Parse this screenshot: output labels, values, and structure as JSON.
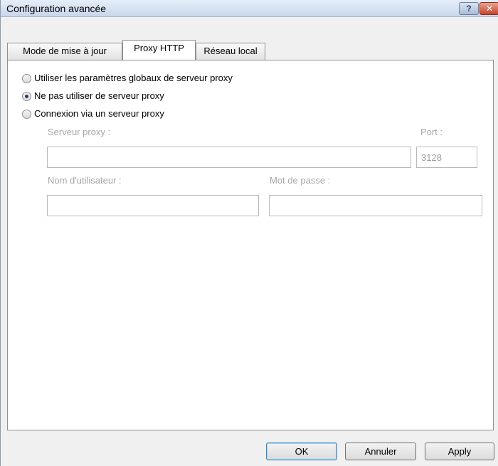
{
  "window": {
    "title": "Configuration avancée",
    "help_label": "?",
    "close_label": "✕"
  },
  "tabs": [
    {
      "label": "Mode de mise à jour",
      "active": false
    },
    {
      "label": "Proxy HTTP",
      "active": true
    },
    {
      "label": "Réseau local",
      "active": false
    }
  ],
  "proxy": {
    "options": [
      {
        "label": "Utiliser les paramètres globaux de serveur proxy",
        "checked": false
      },
      {
        "label": "Ne pas utiliser de serveur proxy",
        "checked": true
      },
      {
        "label": "Connexion via un serveur proxy",
        "checked": false
      }
    ],
    "server_label": "Serveur proxy :",
    "server_value": "",
    "port_label": "Port :",
    "port_value": "3128",
    "username_label": "Nom d'utilisateur :",
    "username_value": "",
    "password_label": "Mot de passe :",
    "password_value": ""
  },
  "footer": {
    "ok_label": "OK",
    "cancel_label": "Annuler",
    "apply_label": "Apply"
  }
}
